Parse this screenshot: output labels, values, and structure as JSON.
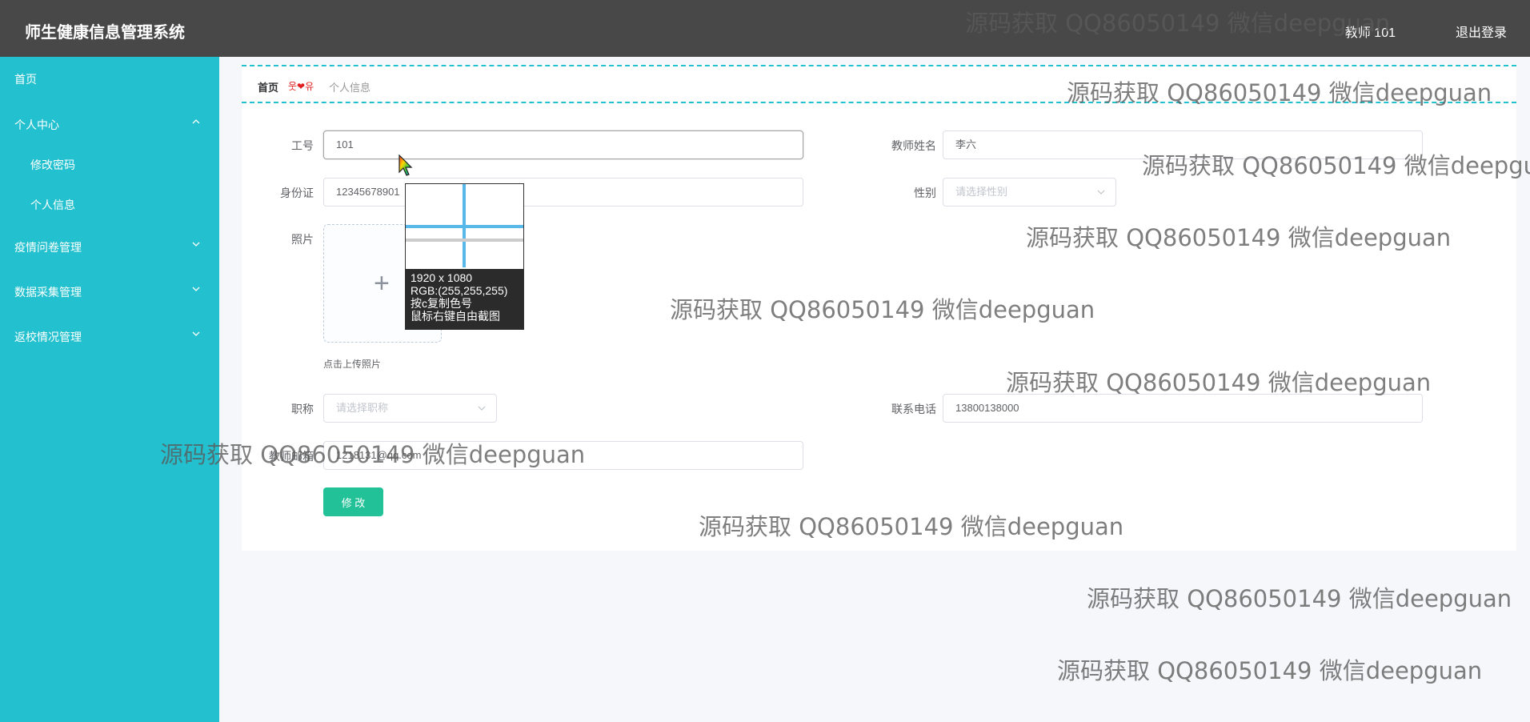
{
  "header": {
    "app_title": "师生健康信息管理系统",
    "user_label": "教师 101",
    "logout_label": "退出登录"
  },
  "sidebar": {
    "items": [
      {
        "label": "首页"
      },
      {
        "label": "个人中心",
        "expanded": true
      },
      {
        "label": "修改密码"
      },
      {
        "label": "个人信息"
      },
      {
        "label": "疫情问卷管理"
      },
      {
        "label": "数据采集管理"
      },
      {
        "label": "返校情况管理"
      }
    ]
  },
  "breadcrumb": {
    "home": "首页",
    "separator": "❤",
    "current": "个人信息"
  },
  "form": {
    "job_id": {
      "label": "工号",
      "value": "101"
    },
    "teacher_name": {
      "label": "教师姓名",
      "value": "李六"
    },
    "id_card": {
      "label": "身份证",
      "value": "12345678901"
    },
    "gender": {
      "label": "性别",
      "placeholder": "请选择性别"
    },
    "photo": {
      "label": "照片",
      "hint": "点击上传照片"
    },
    "title": {
      "label": "职称",
      "placeholder": "请选择职称"
    },
    "phone": {
      "label": "联系电话",
      "value": "13800138000"
    },
    "email": {
      "label": "教师邮箱",
      "value": "1218131@qq.com"
    },
    "submit_label": "修 改"
  },
  "color_picker": {
    "size": "1920 x 1080",
    "rgb": "RGB:(255,255,255)",
    "copy_hint": "按c复制色号",
    "screenshot_hint": "鼠标右键自由截图"
  },
  "watermark_text": "源码获取 QQ86050149 微信deepguan",
  "colors": {
    "sidebar": "#23c1cf",
    "header": "#484848",
    "button": "#23c197"
  }
}
